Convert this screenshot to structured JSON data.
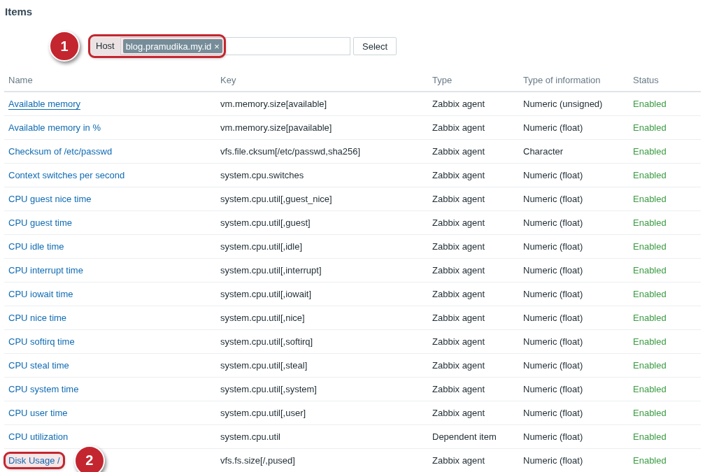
{
  "title": "Items",
  "filter": {
    "label": "Host",
    "chips": [
      "blog.pramudika.my.id"
    ],
    "chip_remove": "×",
    "button": "Select",
    "highlighted": true,
    "callout": "1"
  },
  "table": {
    "columns": [
      "Name",
      "Key",
      "Type",
      "Type of information",
      "Status"
    ],
    "rows": [
      {
        "name": "Available memory",
        "key": "vm.memory.size[available]",
        "type": "Zabbix agent",
        "info": "Numeric (unsigned)",
        "status": "Enabled",
        "hovered": true,
        "highlighted": false
      },
      {
        "name": "Available memory in %",
        "key": "vm.memory.size[pavailable]",
        "type": "Zabbix agent",
        "info": "Numeric (float)",
        "status": "Enabled",
        "hovered": false,
        "highlighted": false
      },
      {
        "name": "Checksum of /etc/passwd",
        "key": "vfs.file.cksum[/etc/passwd,sha256]",
        "type": "Zabbix agent",
        "info": "Character",
        "status": "Enabled",
        "hovered": false,
        "highlighted": false
      },
      {
        "name": "Context switches per second",
        "key": "system.cpu.switches",
        "type": "Zabbix agent",
        "info": "Numeric (float)",
        "status": "Enabled",
        "hovered": false,
        "highlighted": false
      },
      {
        "name": "CPU guest nice time",
        "key": "system.cpu.util[,guest_nice]",
        "type": "Zabbix agent",
        "info": "Numeric (float)",
        "status": "Enabled",
        "hovered": false,
        "highlighted": false
      },
      {
        "name": "CPU guest time",
        "key": "system.cpu.util[,guest]",
        "type": "Zabbix agent",
        "info": "Numeric (float)",
        "status": "Enabled",
        "hovered": false,
        "highlighted": false
      },
      {
        "name": "CPU idle time",
        "key": "system.cpu.util[,idle]",
        "type": "Zabbix agent",
        "info": "Numeric (float)",
        "status": "Enabled",
        "hovered": false,
        "highlighted": false
      },
      {
        "name": "CPU interrupt time",
        "key": "system.cpu.util[,interrupt]",
        "type": "Zabbix agent",
        "info": "Numeric (float)",
        "status": "Enabled",
        "hovered": false,
        "highlighted": false
      },
      {
        "name": "CPU iowait time",
        "key": "system.cpu.util[,iowait]",
        "type": "Zabbix agent",
        "info": "Numeric (float)",
        "status": "Enabled",
        "hovered": false,
        "highlighted": false
      },
      {
        "name": "CPU nice time",
        "key": "system.cpu.util[,nice]",
        "type": "Zabbix agent",
        "info": "Numeric (float)",
        "status": "Enabled",
        "hovered": false,
        "highlighted": false
      },
      {
        "name": "CPU softirq time",
        "key": "system.cpu.util[,softirq]",
        "type": "Zabbix agent",
        "info": "Numeric (float)",
        "status": "Enabled",
        "hovered": false,
        "highlighted": false
      },
      {
        "name": "CPU steal time",
        "key": "system.cpu.util[,steal]",
        "type": "Zabbix agent",
        "info": "Numeric (float)",
        "status": "Enabled",
        "hovered": false,
        "highlighted": false
      },
      {
        "name": "CPU system time",
        "key": "system.cpu.util[,system]",
        "type": "Zabbix agent",
        "info": "Numeric (float)",
        "status": "Enabled",
        "hovered": false,
        "highlighted": false
      },
      {
        "name": "CPU user time",
        "key": "system.cpu.util[,user]",
        "type": "Zabbix agent",
        "info": "Numeric (float)",
        "status": "Enabled",
        "hovered": false,
        "highlighted": false
      },
      {
        "name": "CPU utilization",
        "key": "system.cpu.util",
        "type": "Dependent item",
        "info": "Numeric (float)",
        "status": "Enabled",
        "hovered": false,
        "highlighted": false
      },
      {
        "name": "Disk Usage /",
        "key": "vfs.fs.size[/,pused]",
        "type": "Zabbix agent",
        "info": "Numeric (float)",
        "status": "Enabled",
        "hovered": false,
        "highlighted": true,
        "callout": "2"
      }
    ]
  }
}
